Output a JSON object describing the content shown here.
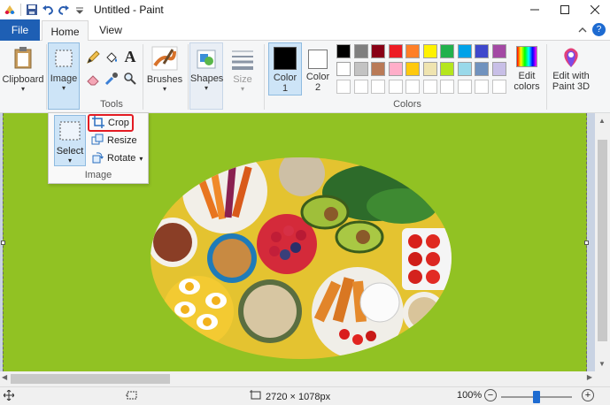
{
  "window": {
    "title": "Untitled - Paint"
  },
  "tabs": {
    "file": "File",
    "home": "Home",
    "view": "View"
  },
  "ribbon": {
    "clipboard": "Clipboard",
    "image": "Image",
    "tools_label": "Tools",
    "brushes": "Brushes",
    "shapes": "Shapes",
    "size": "Size",
    "color1_line1": "Color",
    "color1_line2": "1",
    "color2_line1": "Color",
    "color2_line2": "2",
    "colors_label": "Colors",
    "edit_colors_line1": "Edit",
    "edit_colors_line2": "colors",
    "paint3d_line1": "Edit with",
    "paint3d_line2": "Paint 3D"
  },
  "palette": {
    "row1": [
      "#000000",
      "#7f7f7f",
      "#880015",
      "#ed1c24",
      "#ff7f27",
      "#fff200",
      "#22b14c",
      "#00a2e8",
      "#3f48cc",
      "#a349a4"
    ],
    "row2": [
      "#ffffff",
      "#c3c3c3",
      "#b97a57",
      "#ffaec9",
      "#ffc90e",
      "#efe4b0",
      "#b5e61d",
      "#99d9ea",
      "#7092be",
      "#c8bfe7"
    ],
    "color1": "#000000",
    "color2": "#ffffff"
  },
  "image_menu": {
    "select": "Select",
    "crop": "Crop",
    "resize": "Resize",
    "rotate": "Rotate",
    "group_label": "Image"
  },
  "canvas": {
    "background": "#91c223"
  },
  "status": {
    "dimensions": "2720 × 1078px",
    "zoom": "100%"
  },
  "zoom_level": 0.5
}
